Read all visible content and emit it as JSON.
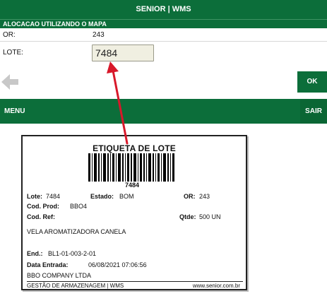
{
  "header": {
    "title": "SENIOR | WMS"
  },
  "section": {
    "title": "ALOCACAO UTILIZANDO O MAPA"
  },
  "fields": {
    "or_label": "OR:",
    "or_value": "243",
    "lote_label": "LOTE:",
    "lote_value": "7484"
  },
  "actions": {
    "ok_label": "OK",
    "menu_label": "MENU",
    "sair_label": "SAIR",
    "back_icon": "arrow-left-icon"
  },
  "label": {
    "title": "ETIQUETA DE LOTE",
    "barcode_number": "7484",
    "lote_label": "Lote:",
    "lote_value": "7484",
    "estado_label": "Estado:",
    "estado_value": "BOM",
    "or_label": "OR:",
    "or_value": "243",
    "cod_prod_label": "Cod. Prod:",
    "cod_prod_value": "BBO4",
    "cod_ref_label": "Cod. Ref:",
    "qtde_label": "Qtde:",
    "qtde_value": "500 UN",
    "description": "VELA AROMATIZADORA CANELA",
    "end_label": "End.:",
    "end_value": "BL1-01-003-2-01",
    "data_entrada_label": "Data Entrada:",
    "data_entrada_value": "06/08/2021 07:06:56",
    "company": "BBO COMPANY LTDA",
    "footer_left": "GESTÃO DE ARMAZENAGEM | WMS",
    "footer_right": "www.senior.com.br"
  },
  "colors": {
    "brand_green": "#0c6e3a",
    "arrow_red": "#d8182a",
    "input_bg": "#f0efe1"
  }
}
